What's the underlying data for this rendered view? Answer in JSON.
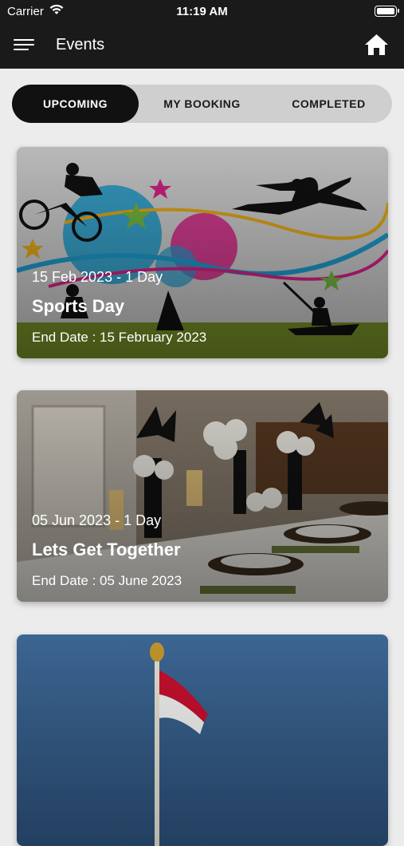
{
  "status_bar": {
    "carrier": "Carrier",
    "time": "11:19 AM",
    "wifi_icon": "wifi-icon",
    "battery_icon": "battery-icon"
  },
  "header": {
    "title": "Events",
    "menu_icon": "hamburger-menu-icon",
    "home_icon": "home-icon"
  },
  "tabs": [
    {
      "label": "UPCOMING",
      "active": true
    },
    {
      "label": "MY BOOKING",
      "active": false
    },
    {
      "label": "COMPLETED",
      "active": false
    }
  ],
  "events": [
    {
      "dates": "15 Feb 2023 - 1 Day",
      "name": "Sports Day",
      "end_date": "End Date : 15 February 2023"
    },
    {
      "dates": "05 Jun 2023 - 1 Day",
      "name": "Lets Get Together",
      "end_date": "End Date : 05 June 2023"
    },
    {
      "dates": "",
      "name": "",
      "end_date": ""
    }
  ],
  "colors": {
    "header_bg": "#1a1a1a",
    "tab_active_bg": "#111111",
    "tab_track_bg": "#cfcfcf",
    "page_bg": "#ececec"
  }
}
